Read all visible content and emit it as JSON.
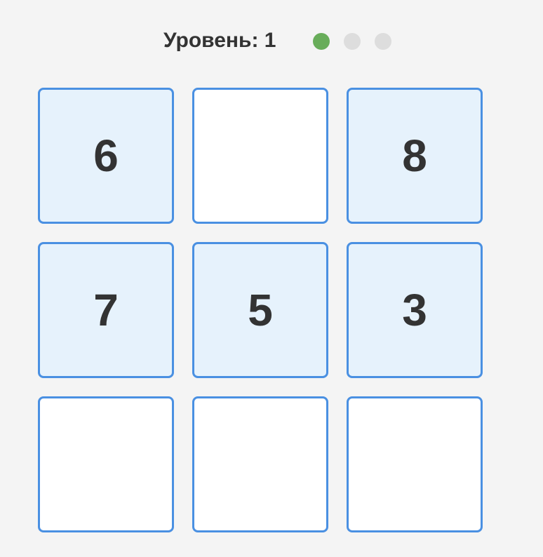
{
  "header": {
    "level_text": "Уровень: 1",
    "progress_dots": [
      {
        "state": "active",
        "color": "#68ad5a"
      },
      {
        "state": "inactive",
        "color": "#dddddd"
      },
      {
        "state": "inactive",
        "color": "#dddddd"
      }
    ]
  },
  "board": {
    "colors": {
      "border": "#4a90e2",
      "filled_bg": "#e6f2fc",
      "empty_bg": "#ffffff",
      "text": "#333333"
    },
    "cells": [
      {
        "value": "6"
      },
      {
        "value": ""
      },
      {
        "value": "8"
      },
      {
        "value": "7"
      },
      {
        "value": "5"
      },
      {
        "value": "3"
      },
      {
        "value": ""
      },
      {
        "value": ""
      },
      {
        "value": ""
      }
    ]
  }
}
